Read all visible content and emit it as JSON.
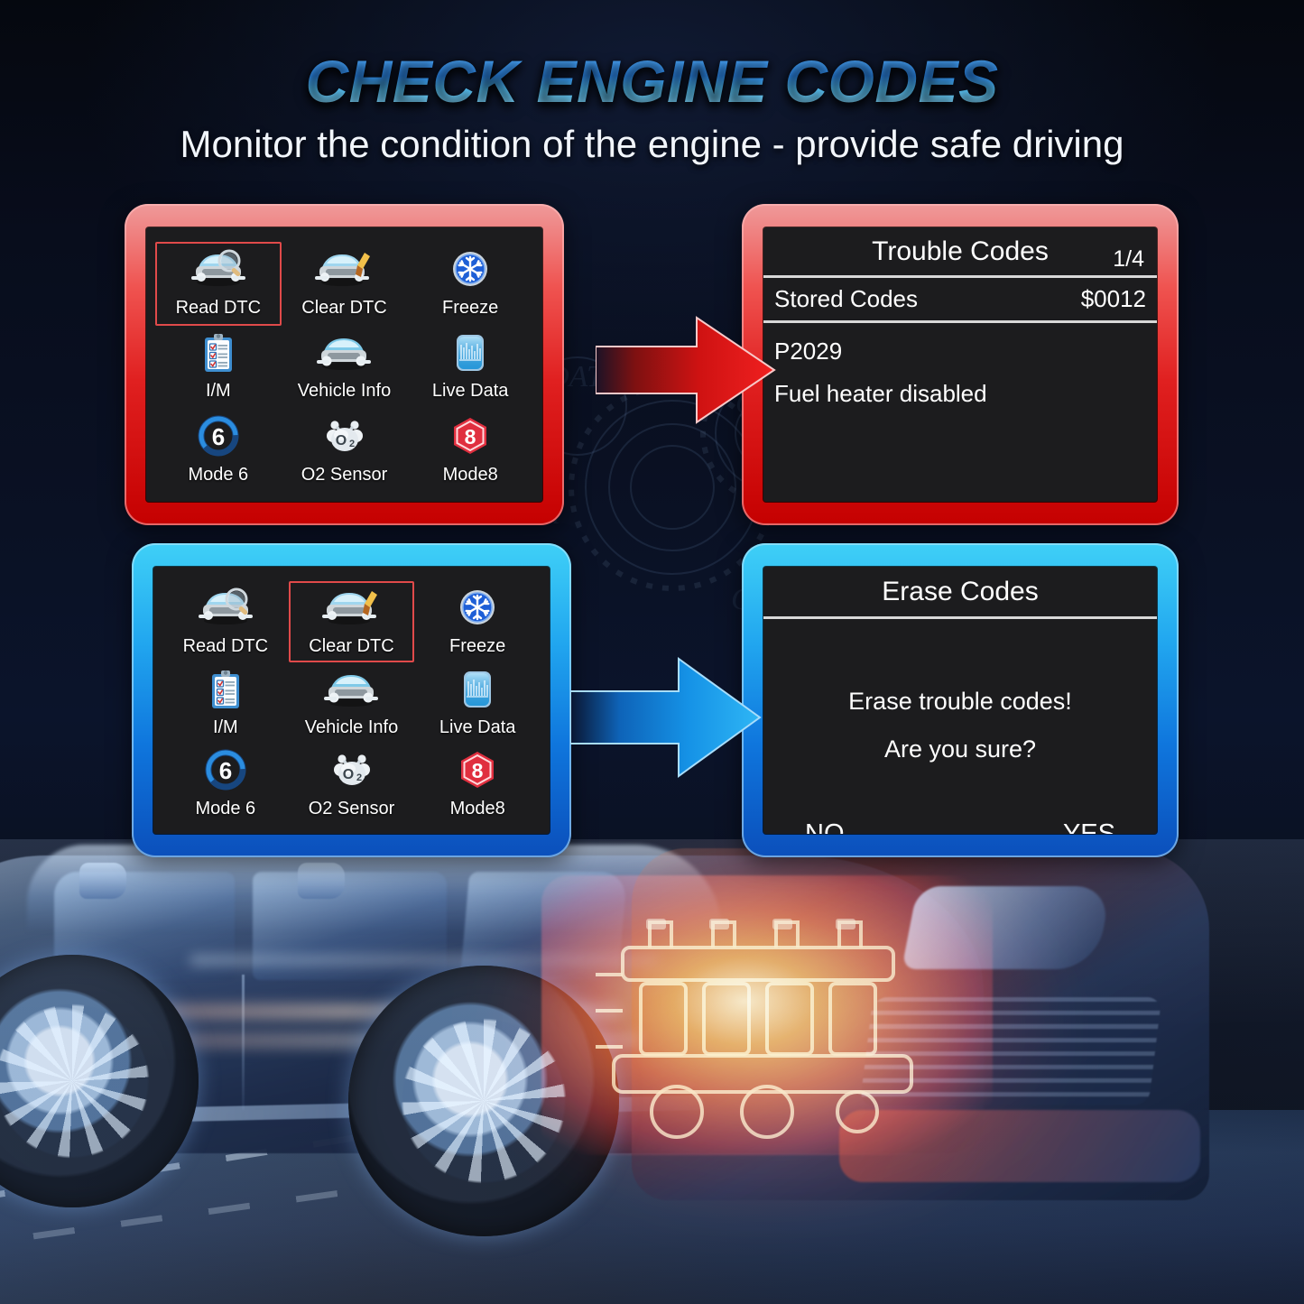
{
  "header": {
    "title": "CHECK ENGINE CODES",
    "subtitle": "Monitor the condition of the engine - provide safe driving",
    "title_color": "#3b9bf5",
    "subtitle_color": "#f2f6fc"
  },
  "panels": {
    "read_dtc_menu": {
      "accent": "#e02020",
      "selected": "Read DTC",
      "items": [
        {
          "label": "Read DTC",
          "icon": "car-magnifier-icon"
        },
        {
          "label": "Clear DTC",
          "icon": "car-brush-icon"
        },
        {
          "label": "Freeze",
          "icon": "snowflake-icon"
        },
        {
          "label": "I/M",
          "icon": "clipboard-checklist-icon"
        },
        {
          "label": "Vehicle Info",
          "icon": "car-front-icon"
        },
        {
          "label": "Live Data",
          "icon": "live-chart-icon"
        },
        {
          "label": "Mode 6",
          "icon": "ring-six-icon"
        },
        {
          "label": "O2 Sensor",
          "icon": "o2-molecule-icon"
        },
        {
          "label": "Mode8",
          "icon": "hexagon-eight-icon"
        }
      ]
    },
    "clear_dtc_menu": {
      "accent": "#0f76dd",
      "selected": "Clear DTC",
      "items": [
        {
          "label": "Read DTC",
          "icon": "car-magnifier-icon"
        },
        {
          "label": "Clear DTC",
          "icon": "car-brush-icon"
        },
        {
          "label": "Freeze",
          "icon": "snowflake-icon"
        },
        {
          "label": "I/M",
          "icon": "clipboard-checklist-icon"
        },
        {
          "label": "Vehicle Info",
          "icon": "car-front-icon"
        },
        {
          "label": "Live Data",
          "icon": "live-chart-icon"
        },
        {
          "label": "Mode 6",
          "icon": "ring-six-icon"
        },
        {
          "label": "O2 Sensor",
          "icon": "o2-molecule-icon"
        },
        {
          "label": "Mode8",
          "icon": "hexagon-eight-icon"
        }
      ]
    },
    "trouble_codes": {
      "accent": "#e02020",
      "title": "Trouble Codes",
      "page": "1/4",
      "row_label": "Stored Codes",
      "row_value": "$0012",
      "code": "P2029",
      "description": "Fuel heater disabled"
    },
    "erase_codes": {
      "accent": "#0f76dd",
      "title": "Erase Codes",
      "line1": "Erase trouble codes!",
      "line2": "Are you sure?",
      "no_label": "NO",
      "yes_label": "YES"
    }
  },
  "arrows": {
    "red_arrow": "arrow-right-red",
    "blue_arrow": "arrow-right-blue"
  }
}
